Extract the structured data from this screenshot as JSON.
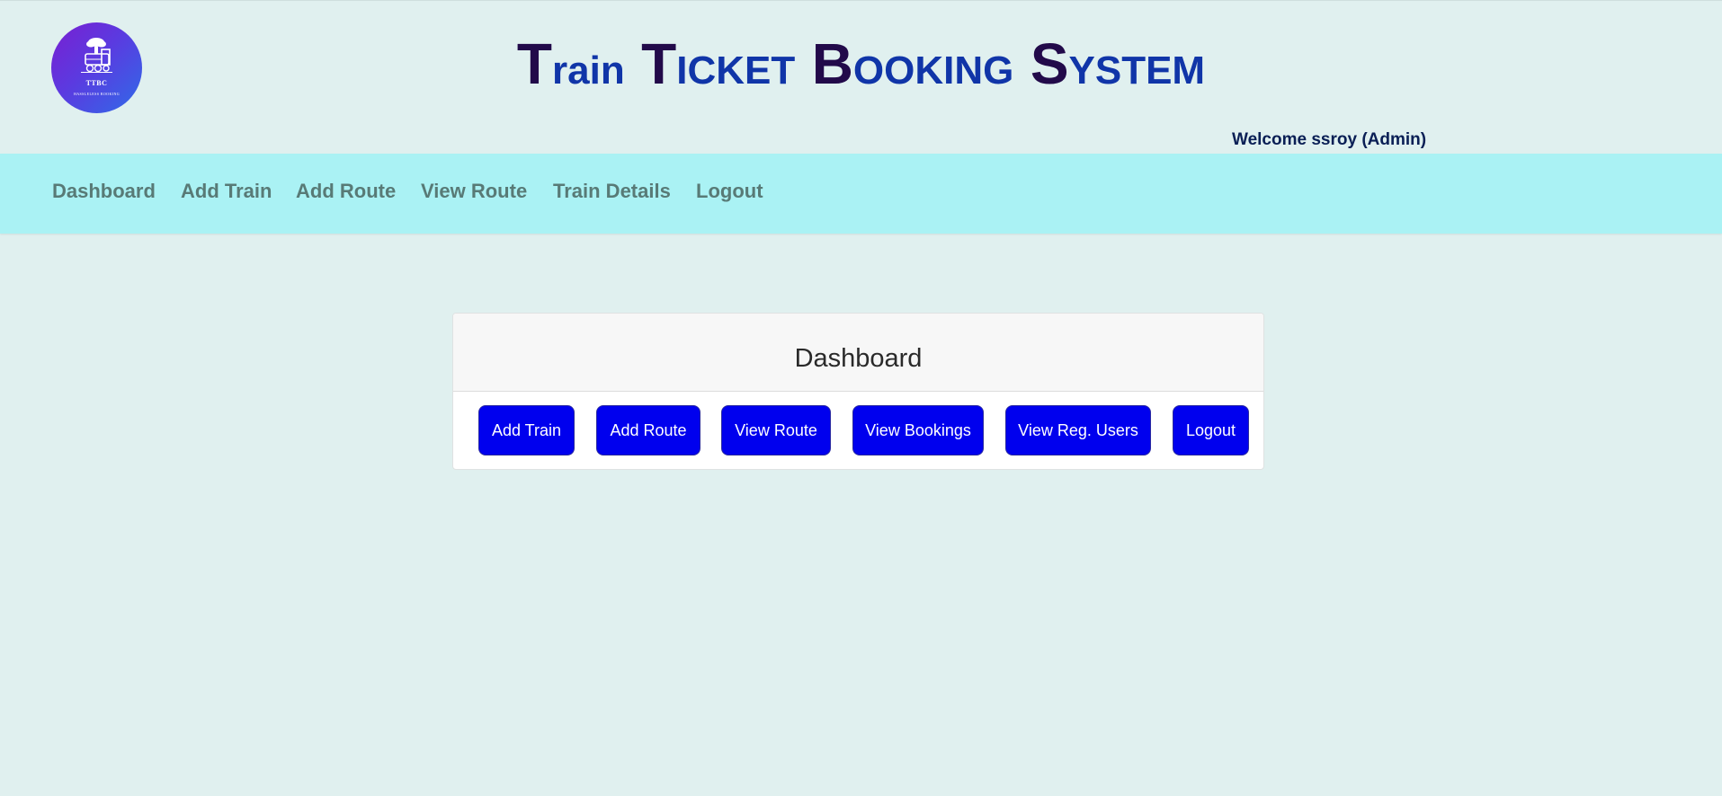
{
  "logo": {
    "abbr": "TTBC",
    "tagline": "HASSLELESS BOOKING",
    "icon": "steam-train-icon",
    "colors": [
      "#7a1fd1",
      "#2f6be8"
    ]
  },
  "site_title": {
    "words": [
      {
        "initial": "T",
        "rest": "rain"
      },
      {
        "initial": "T",
        "rest": "ICKET"
      },
      {
        "initial": "B",
        "rest": "OOKING"
      },
      {
        "initial": "S",
        "rest": "YSTEM"
      }
    ]
  },
  "welcome": "Welcome ssroy (Admin)",
  "nav": {
    "items": [
      {
        "label": "Dashboard"
      },
      {
        "label": "Add Train"
      },
      {
        "label": "Add Route"
      },
      {
        "label": "View Route"
      },
      {
        "label": "Train Details"
      },
      {
        "label": "Logout"
      }
    ]
  },
  "dashboard": {
    "title": "Dashboard",
    "buttons": [
      {
        "label": "Add Train"
      },
      {
        "label": "Add Route"
      },
      {
        "label": "View Route"
      },
      {
        "label": "View Bookings"
      },
      {
        "label": "View Reg. Users"
      },
      {
        "label": "Logout"
      }
    ]
  },
  "colors": {
    "page_bg": "#e0f0ef",
    "navbar_bg": "#aaf2f4",
    "button_bg": "#0000ee",
    "title_initial": "#220a4a",
    "title_rest": "#1035a8"
  }
}
